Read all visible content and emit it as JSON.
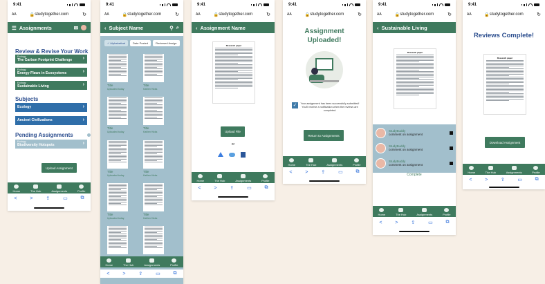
{
  "status_time": "9:41",
  "url": "studytogether.com",
  "url_aa": "AA",
  "icons": {
    "reload": "reload-icon",
    "back": "chevron-left-icon",
    "forward": "chevron-right-icon",
    "share": "share-icon",
    "book": "book-icon",
    "tabs": "tabs-icon"
  },
  "tabs": [
    "Home",
    "The Hub",
    "Assignments",
    "Profile"
  ],
  "browser_glyphs": [
    "<",
    ">",
    "⇪",
    "▭",
    "⧉"
  ],
  "screen1": {
    "header": "Assignments",
    "review_title": "Review & Revise Your Work",
    "reviews": [
      {
        "tag": "Ecology",
        "title": "The Carbon Footprint Challenge"
      },
      {
        "tag": "Ecology",
        "title": "Energy Flaws in Ecosystems"
      },
      {
        "tag": "Ecology",
        "title": "Sustainable Living"
      }
    ],
    "subjects_title": "Subjects",
    "subjects": [
      "Ecology",
      "Ancient Civilizations"
    ],
    "pending_title": "Pending Assignments",
    "pending": [
      {
        "tag": "Ecology",
        "title": "Biodiversity Hotspots"
      }
    ],
    "upload_button": "Upload Assignment"
  },
  "screen2": {
    "header": "Subject Name",
    "filters": [
      "✓ Alphabetical",
      "Date Posted",
      "Reviewed Assign"
    ],
    "items": [
      {
        "title": "Title",
        "sub": "Uploaded today"
      },
      {
        "title": "Title",
        "sub": "Kahlen Hicks"
      },
      {
        "title": "Title",
        "sub": "Uploaded today"
      },
      {
        "title": "Title",
        "sub": "Kahlen Hicks"
      },
      {
        "title": "Title",
        "sub": "Uploaded today"
      },
      {
        "title": "Title",
        "sub": "Kahlen Hicks"
      },
      {
        "title": "Title",
        "sub": "Uploaded today"
      },
      {
        "title": "Title",
        "sub": "Kahlen Hicks"
      },
      {
        "title": "Title",
        "sub": "Uploaded today"
      },
      {
        "title": "Title",
        "sub": "Kahlen Hicks"
      }
    ]
  },
  "screen3": {
    "header": "Assignment Name",
    "doc_title": "Research paper",
    "upload_button": "Upload File",
    "or": "or",
    "providers": [
      "google-drive-icon",
      "cloud-icon",
      "word-icon"
    ]
  },
  "screen4": {
    "title_line1": "Assignment",
    "title_line2": "Uploaded!",
    "notice": "Your assignment has been successfully submitted! You'll receive a notification when the reviews are completed.",
    "return_button": "Return to Assignments"
  },
  "screen5": {
    "header": "Sustainable Living",
    "doc_title": "Research paper",
    "reviewers": [
      {
        "name": "StudyBuddy",
        "comment": "comment on assignment"
      },
      {
        "name": "StudyBuddy",
        "comment": "comment on assignment"
      },
      {
        "name": "StudyBuddy",
        "comment": "comment on assignment"
      }
    ],
    "complete": "Complete"
  },
  "screen6": {
    "title": "Reviews Complete!",
    "doc_title": "Research paper",
    "download_button": "Download Assignment"
  },
  "colors": {
    "primary": "#3f7a5e",
    "navy": "#2d4f8f",
    "blue": "#2f6ea9",
    "pale": "#a2bfcc",
    "bg": "#f7efe6"
  }
}
